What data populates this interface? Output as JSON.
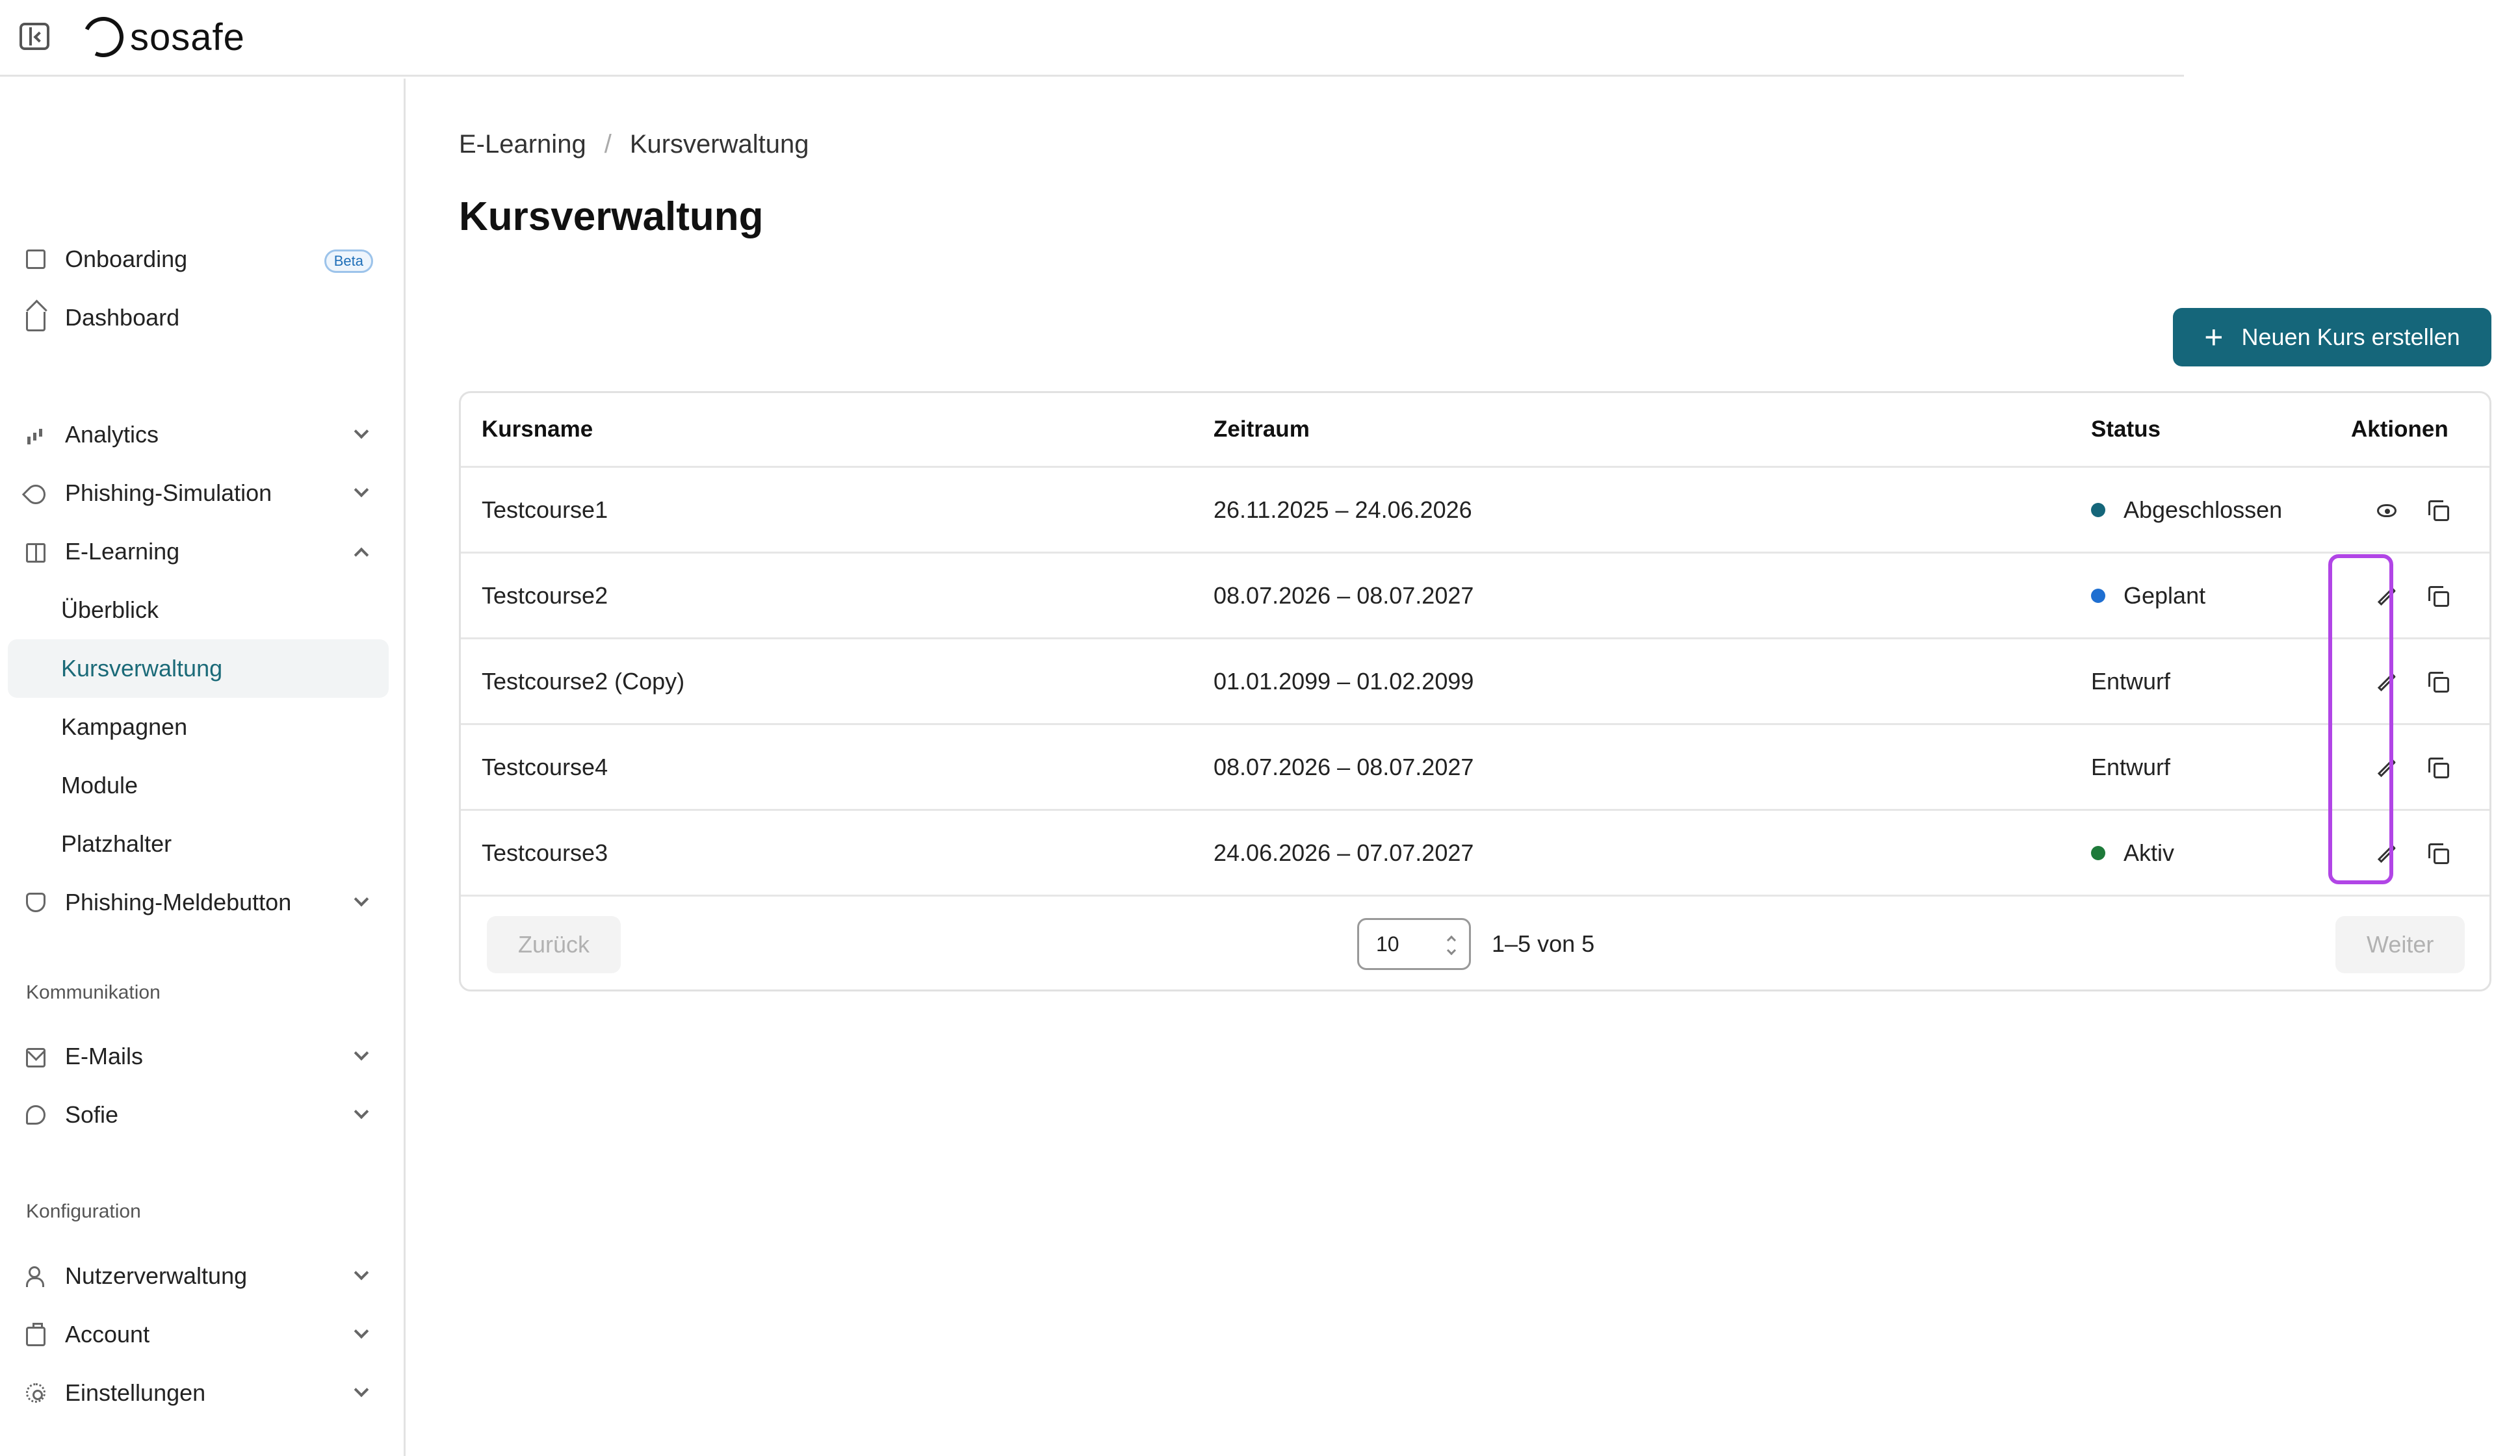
{
  "header": {
    "brand": "sosafe"
  },
  "sidebar": {
    "items": [
      {
        "label": "Onboarding",
        "badge": "Beta",
        "icon": "document-icon"
      },
      {
        "label": "Dashboard",
        "icon": "home-icon"
      },
      {
        "label": "Analytics",
        "icon": "bar-chart-icon"
      },
      {
        "label": "Phishing-Simulation",
        "icon": "rocket-icon"
      },
      {
        "label": "E-Learning",
        "icon": "book-icon",
        "expanded": true
      },
      {
        "label": "Überblick"
      },
      {
        "label": "Kursverwaltung",
        "active": true
      },
      {
        "label": "Kampagnen"
      },
      {
        "label": "Module"
      },
      {
        "label": "Platzhalter"
      },
      {
        "label": "Phishing-Meldebutton",
        "icon": "shield-icon"
      },
      {
        "label": "E-Mails",
        "icon": "mail-icon"
      },
      {
        "label": "Sofie",
        "icon": "chat-icon"
      },
      {
        "label": "Nutzerverwaltung",
        "icon": "users-icon"
      },
      {
        "label": "Account",
        "icon": "briefcase-icon"
      },
      {
        "label": "Einstellungen",
        "icon": "gear-icon"
      }
    ],
    "sections": {
      "communication": "Kommunikation",
      "configuration": "Konfiguration"
    }
  },
  "breadcrumb": {
    "parent": "E-Learning",
    "separator": "/",
    "current": "Kursverwaltung"
  },
  "page": {
    "title": "Kursverwaltung",
    "create_button": "Neuen Kurs erstellen"
  },
  "table": {
    "headers": {
      "name": "Kursname",
      "range": "Zeitraum",
      "status": "Status",
      "actions": "Aktionen"
    },
    "rows": [
      {
        "name": "Testcourse1",
        "range": "26.11.2025 – 24.06.2026",
        "status": "Abgeschlossen",
        "status_color": "#15667a",
        "actions": [
          "view",
          "copy"
        ]
      },
      {
        "name": "Testcourse2",
        "range": "08.07.2026 – 08.07.2027",
        "status": "Geplant",
        "status_color": "#1f6fd1",
        "actions": [
          "edit",
          "copy"
        ]
      },
      {
        "name": "Testcourse2 (Copy)",
        "range": "01.01.2099 – 01.02.2099",
        "status": "Entwurf",
        "status_color": "",
        "actions": [
          "edit",
          "copy"
        ]
      },
      {
        "name": "Testcourse4",
        "range": "08.07.2026 – 08.07.2027",
        "status": "Entwurf",
        "status_color": "",
        "actions": [
          "edit",
          "copy"
        ]
      },
      {
        "name": "Testcourse3",
        "range": "24.06.2026 – 07.07.2027",
        "status": "Aktiv",
        "status_color": "#1e7a3a",
        "actions": [
          "edit",
          "copy"
        ]
      }
    ]
  },
  "pagination": {
    "prev": "Zurück",
    "page_size": "10",
    "range": "1–5 von 5",
    "next": "Weiter"
  },
  "colors": {
    "primary": "#15667a",
    "highlight": "#b145e6"
  }
}
